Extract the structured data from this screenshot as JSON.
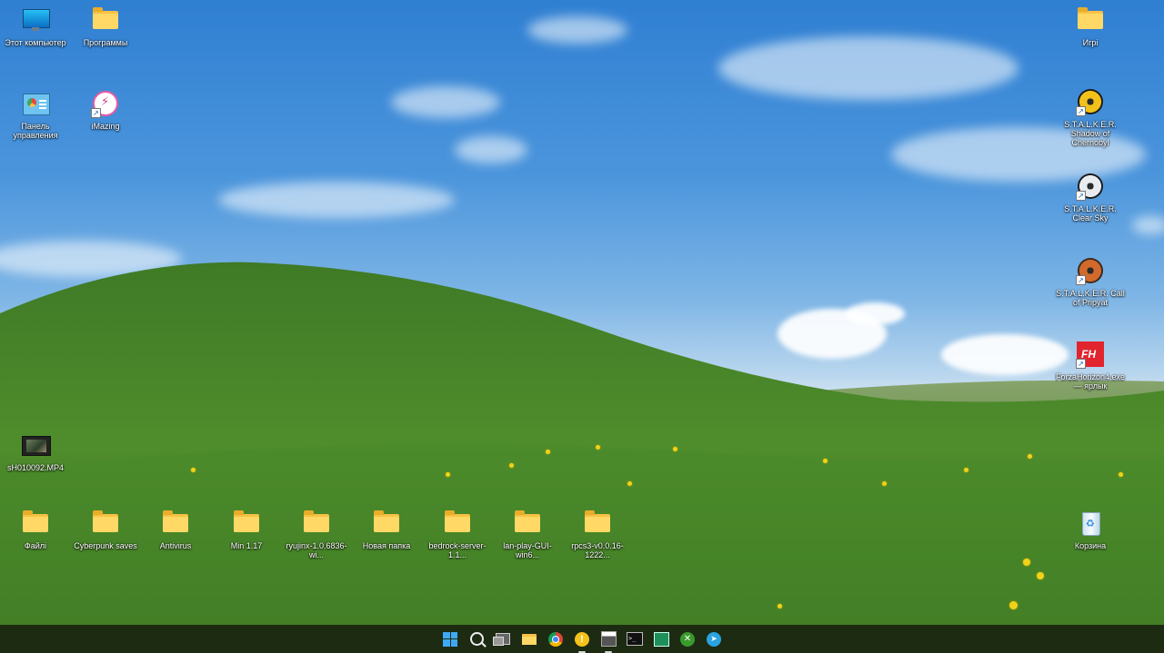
{
  "desktop": {
    "icons_left": [
      {
        "label": "Этот компьютер",
        "icon": "monitor-icon"
      },
      {
        "label": "Программы",
        "icon": "folder-icon"
      },
      {
        "label": "Панель управления",
        "icon": "control-panel-icon"
      },
      {
        "label": "iMazing",
        "icon": "imazing-icon",
        "shortcut": true
      },
      {
        "label": "sH010092.MP4",
        "icon": "video-file-icon"
      }
    ],
    "icons_bottom": [
      {
        "label": "Файлі",
        "icon": "folder-icon"
      },
      {
        "label": "Cyberpunk saves",
        "icon": "folder-icon"
      },
      {
        "label": "Antivirus",
        "icon": "folder-icon"
      },
      {
        "label": "Min 1.17",
        "icon": "folder-icon"
      },
      {
        "label": "ryujinx-1.0.6836-wi...",
        "icon": "folder-icon"
      },
      {
        "label": "Новая папка",
        "icon": "folder-icon"
      },
      {
        "label": "bedrock-server-1.1...",
        "icon": "folder-icon"
      },
      {
        "label": "lan-play-GUI-win6...",
        "icon": "folder-icon"
      },
      {
        "label": "rpcs3-v0.0.16-1222...",
        "icon": "folder-icon"
      }
    ],
    "icons_right": [
      {
        "label": "Игрі",
        "icon": "folder-icon"
      },
      {
        "label": "S.T.A.L.K.E.R. Shadow of Chernobyl",
        "icon": "stalker-soc-icon",
        "shortcut": true
      },
      {
        "label": "S.T.A.L.K.E.R. Clear Sky",
        "icon": "stalker-cs-icon",
        "shortcut": true
      },
      {
        "label": "S.T.A.L.K.E.R. Call of Pripyat",
        "icon": "stalker-cop-icon",
        "shortcut": true
      },
      {
        "label": "ForzaHorizon4.exe — ярлык",
        "icon": "forza-icon",
        "shortcut": true
      },
      {
        "label": "Корзина",
        "icon": "recycle-bin-icon"
      }
    ],
    "shortcut_arrow": "↗"
  },
  "taskbar": {
    "buttons": [
      {
        "name": "start-button",
        "icon": "windows-logo-icon"
      },
      {
        "name": "search-button",
        "icon": "search-icon"
      },
      {
        "name": "task-view-button",
        "icon": "task-view-icon"
      },
      {
        "name": "file-explorer-button",
        "icon": "folder-icon"
      },
      {
        "name": "chrome-button",
        "icon": "chrome-icon"
      },
      {
        "name": "yellow-app-button",
        "icon": "yellow-app-icon",
        "active": true
      },
      {
        "name": "app-button",
        "icon": "app-icon",
        "active": true
      },
      {
        "name": "terminal-button",
        "icon": "terminal-icon"
      },
      {
        "name": "green-app-button",
        "icon": "green-app-icon"
      },
      {
        "name": "xbox-button",
        "icon": "xbox-icon"
      },
      {
        "name": "telegram-button",
        "icon": "telegram-icon"
      }
    ]
  },
  "colors": {
    "taskbar_bg": "#1c2b12",
    "folder_yellow": "#ffd865",
    "sky_top": "#2f7fd2",
    "grass": "#4f8a2a"
  }
}
